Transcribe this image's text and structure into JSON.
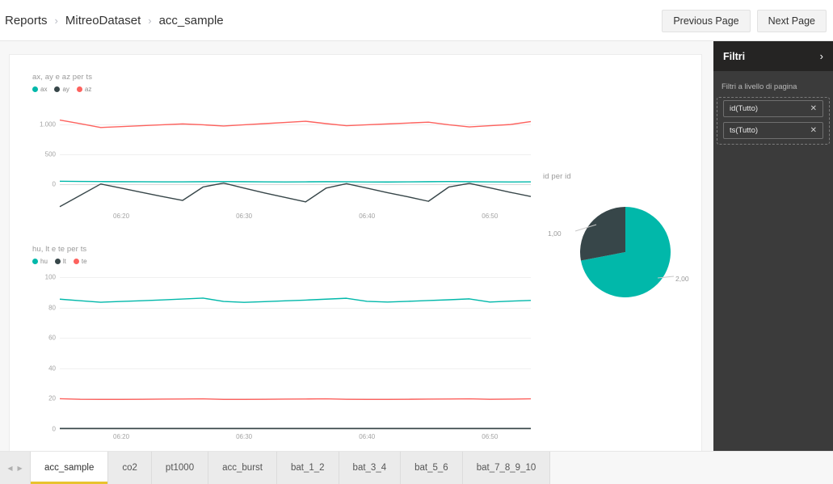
{
  "header": {
    "breadcrumb": [
      "Reports",
      "MitreoDataset",
      "acc_sample"
    ],
    "separator": "›",
    "previous_page_label": "Previous Page",
    "next_page_label": "Next Page"
  },
  "colors": {
    "teal": "#01b8aa",
    "dark": "#374649",
    "red": "#fd625e",
    "accent_tab": "#e8c32e",
    "pane_header_bg": "#252423",
    "pane_bg": "#3b3b3b"
  },
  "filter_pane": {
    "title": "Filtri",
    "expand_icon": "chevron-right-icon",
    "section_label": "Filtri a livello di pagina",
    "filters": [
      {
        "label": "id(Tutto)",
        "clear_icon": "close-icon"
      },
      {
        "label": "ts(Tutto)",
        "clear_icon": "close-icon"
      }
    ]
  },
  "tabbar": {
    "prev_icon": "chevron-left-icon",
    "next_icon": "chevron-right-icon",
    "tabs": [
      {
        "label": "acc_sample",
        "active": true
      },
      {
        "label": "co2",
        "active": false
      },
      {
        "label": "pt1000",
        "active": false
      },
      {
        "label": "acc_burst",
        "active": false
      },
      {
        "label": "bat_1_2",
        "active": false
      },
      {
        "label": "bat_3_4",
        "active": false
      },
      {
        "label": "bat_5_6",
        "active": false
      },
      {
        "label": "bat_7_8_9_10",
        "active": false
      }
    ]
  },
  "chart_data": [
    {
      "id": "acc_chart",
      "type": "line",
      "title": "ax, ay e az per ts",
      "xlabel": "",
      "ylabel": "",
      "grid": true,
      "legend_position": "top-left",
      "ylim": [
        -400,
        1250
      ],
      "yticks": [
        0,
        500,
        1000
      ],
      "ytick_labels": [
        "0",
        "500",
        "1.000"
      ],
      "x": [
        0,
        1,
        2,
        3,
        4,
        5,
        6,
        7,
        8,
        9,
        10,
        11,
        12,
        13,
        14,
        15,
        16,
        17,
        18,
        19,
        20,
        21,
        22,
        23
      ],
      "xtick_positions": [
        3,
        9,
        15,
        21
      ],
      "xtick_labels": [
        "06:20",
        "06:30",
        "06:40",
        "06:50"
      ],
      "series": [
        {
          "name": "ax",
          "color": "#01b8aa",
          "values": [
            55,
            52,
            50,
            48,
            47,
            46,
            46,
            48,
            50,
            48,
            45,
            44,
            46,
            48,
            47,
            44,
            43,
            45,
            48,
            50,
            48,
            45,
            44,
            46
          ]
        },
        {
          "name": "ay",
          "color": "#374649",
          "values": [
            -370,
            -180,
            10,
            -60,
            -130,
            -200,
            -265,
            -40,
            25,
            -60,
            -140,
            -215,
            -290,
            -60,
            15,
            -60,
            -135,
            -205,
            -280,
            -40,
            20,
            -55,
            -130,
            -200
          ]
        },
        {
          "name": "az",
          "color": "#fd625e",
          "values": [
            1080,
            1020,
            955,
            970,
            985,
            1000,
            1015,
            1000,
            980,
            1000,
            1020,
            1040,
            1060,
            1020,
            985,
            1000,
            1015,
            1030,
            1045,
            1000,
            965,
            985,
            1005,
            1055
          ]
        }
      ]
    },
    {
      "id": "hum_chart",
      "type": "line",
      "title": "hu, lt e te per ts",
      "xlabel": "",
      "ylabel": "",
      "grid": true,
      "legend_position": "top-left",
      "ylim": [
        0,
        100
      ],
      "yticks": [
        0,
        20,
        40,
        60,
        80,
        100
      ],
      "ytick_labels": [
        "0",
        "20",
        "40",
        "60",
        "80",
        "100"
      ],
      "x": [
        0,
        1,
        2,
        3,
        4,
        5,
        6,
        7,
        8,
        9,
        10,
        11,
        12,
        13,
        14,
        15,
        16,
        17,
        18,
        19,
        20,
        21,
        22,
        23
      ],
      "xtick_positions": [
        3,
        9,
        15,
        21
      ],
      "xtick_labels": [
        "06:20",
        "06:30",
        "06:40",
        "06:50"
      ],
      "series": [
        {
          "name": "hu",
          "color": "#01b8aa",
          "values": [
            85.5,
            84.5,
            83.5,
            84.0,
            84.5,
            85.0,
            85.6,
            86.2,
            84.0,
            83.4,
            83.9,
            84.4,
            84.9,
            85.5,
            86.1,
            84.1,
            83.6,
            84.1,
            84.6,
            85.1,
            85.7,
            83.6,
            84.2,
            84.7
          ]
        },
        {
          "name": "lt",
          "color": "#374649",
          "values": [
            0.4,
            0.4,
            0.4,
            0.4,
            0.4,
            0.4,
            0.4,
            0.4,
            0.4,
            0.4,
            0.4,
            0.4,
            0.4,
            0.4,
            0.4,
            0.4,
            0.4,
            0.4,
            0.4,
            0.4,
            0.4,
            0.4,
            0.4,
            0.4
          ]
        },
        {
          "name": "te",
          "color": "#fd625e",
          "values": [
            20.0,
            19.6,
            19.5,
            19.5,
            19.6,
            19.7,
            19.8,
            19.9,
            19.5,
            19.5,
            19.6,
            19.7,
            19.8,
            19.9,
            19.6,
            19.5,
            19.5,
            19.6,
            19.7,
            19.8,
            19.9,
            19.6,
            19.7,
            19.9
          ]
        }
      ]
    },
    {
      "id": "id_pie",
      "type": "pie",
      "title": "id per id",
      "labels": [
        "2,00",
        "1,00"
      ],
      "values": [
        72,
        28
      ],
      "colors": [
        "#01b8aa",
        "#374649"
      ],
      "legend_position": "callout"
    }
  ]
}
